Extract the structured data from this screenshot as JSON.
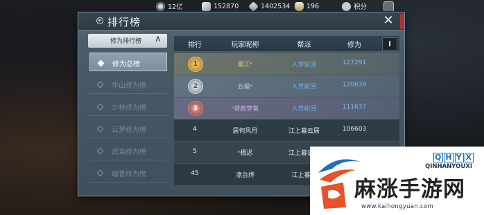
{
  "topbar": {
    "items": [
      {
        "icon": "film-reel-icon",
        "value": "12亿"
      },
      {
        "icon": "silver-coin-icon",
        "value": "152870"
      },
      {
        "icon": "gem-icon",
        "value": "1402534"
      },
      {
        "icon": "money-bag-icon",
        "value": "196"
      },
      {
        "icon": "score-icon",
        "value": "积分"
      }
    ]
  },
  "panel": {
    "title": "排行榜",
    "close": "✕"
  },
  "sidebar": {
    "header": "修为排行榜",
    "header_chevron": "∧",
    "items": [
      {
        "label": "修为总榜",
        "active": true
      },
      {
        "label": "华山修为榜",
        "active": false
      },
      {
        "label": "少林修为榜",
        "active": false
      },
      {
        "label": "云梦修为榜",
        "active": false
      },
      {
        "label": "武当修为榜",
        "active": false
      },
      {
        "label": "暗香修为榜",
        "active": false
      }
    ]
  },
  "table": {
    "headers": [
      "排行",
      "玩家昵称",
      "帮派",
      "修为"
    ],
    "info": "i",
    "rows": [
      {
        "rank": "1",
        "name": "富江ᵛ",
        "guild": "入世轮回",
        "score": "127291",
        "tier": "gold"
      },
      {
        "rank": "2",
        "name": "云燊ᵛ",
        "guild": "入世轮回",
        "score": "120639",
        "tier": "silver"
      },
      {
        "rank": "3",
        "name": "ᵛ荷颜梦鱼",
        "guild": "入世轮回",
        "score": "111637",
        "tier": "bronze"
      },
      {
        "rank": "4",
        "name": "居何风月",
        "guild": "江上暮云居",
        "score": "106603",
        "tier": "plain"
      },
      {
        "rank": "5",
        "name": "ᵛ栖迟",
        "guild": "江上暮云居",
        "score": "",
        "tier": "plain"
      },
      {
        "rank": "45",
        "name": "凛台烨",
        "guild": "江上暮云",
        "score": "",
        "tier": "plain"
      }
    ]
  },
  "watermark": {
    "brand": [
      "Q",
      "H",
      "Y",
      "X"
    ],
    "brand_en": "QINHANYOUXI",
    "brand_cn": "麻涨手游网",
    "url": "www.kaihongyuan.com"
  },
  "colors": {
    "accent_blue": "#6fb0f0",
    "panel_bg": "#4a5b69",
    "gold": "#d2a545",
    "silver": "#aeb9c2",
    "bronze": "#c06a5e"
  }
}
